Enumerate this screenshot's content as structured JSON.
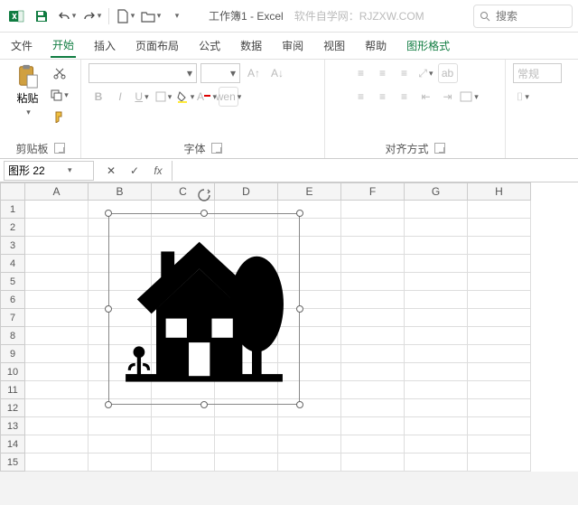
{
  "title_bar": {
    "doc_title": "工作簿1 - Excel",
    "watermark": "软件自学网：RJZXW.COM",
    "search_placeholder": "搜索"
  },
  "tabs": {
    "file": "文件",
    "home": "开始",
    "insert": "插入",
    "page_layout": "页面布局",
    "formulas": "公式",
    "data": "数据",
    "review": "审阅",
    "view": "视图",
    "help": "帮助",
    "shape_format": "图形格式"
  },
  "ribbon": {
    "clipboard": {
      "paste": "粘贴",
      "group": "剪贴板"
    },
    "font": {
      "group": "字体",
      "wen_btn": "wen"
    },
    "align": {
      "group": "对齐方式",
      "wrap": "ab",
      "general": "常规"
    }
  },
  "namebox": {
    "value": "图形 22",
    "formula": ""
  },
  "grid": {
    "cols": [
      "A",
      "B",
      "C",
      "D",
      "E",
      "F",
      "G",
      "H"
    ],
    "rows": [
      "1",
      "2",
      "3",
      "4",
      "5",
      "6",
      "7",
      "8",
      "9",
      "10",
      "11",
      "12",
      "13",
      "14",
      "15"
    ]
  }
}
